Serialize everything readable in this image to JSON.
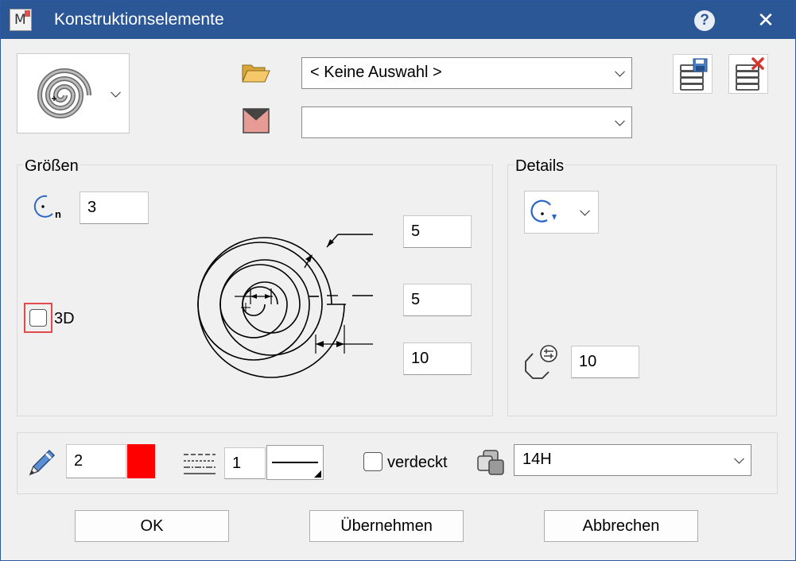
{
  "window": {
    "title": "Konstruktionselemente",
    "app_icon_letter": "M",
    "help": "?",
    "close": "✕"
  },
  "top": {
    "shape_type_icon": "spiral-icon",
    "category_combo": {
      "value": "< Keine Auswahl >"
    },
    "style_combo": {
      "value": ""
    }
  },
  "groesse": {
    "label": "Größen",
    "turns_subscript": "n",
    "turns_value": "3",
    "dim1_value": "5",
    "dim2_value": "5",
    "dim3_value": "10",
    "checkbox_3d_label": "3D",
    "checkbox_3d_checked": false
  },
  "details": {
    "label": "Details",
    "segments_value": "10"
  },
  "bottom": {
    "pen_value": "2",
    "pen_color": "#ff0000",
    "linetype_value": "1",
    "verdeckt_label": "verdeckt",
    "verdeckt_checked": false,
    "layer_value": "14H"
  },
  "buttons": {
    "ok": "OK",
    "apply": "Übernehmen",
    "cancel": "Abbrechen"
  }
}
